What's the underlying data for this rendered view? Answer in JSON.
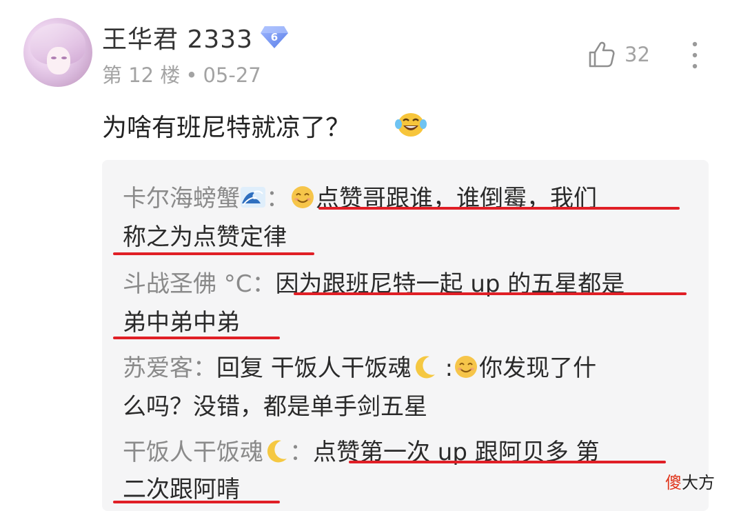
{
  "user": {
    "name": "王华君 2333",
    "level": "6",
    "floor": "第 12 楼",
    "separator": "•",
    "date": "05-27"
  },
  "actions": {
    "like_count": "32"
  },
  "comment": {
    "text": "为啥有班尼特就凉了？",
    "emoji": "laughing-tears-emoji"
  },
  "replies": [
    {
      "author": "卡尔海螃蟹",
      "author_emoji": "wave-emoji",
      "colon": "：",
      "text_emoji": "smile-emoji",
      "text_line1": "点赞哥跟谁，谁倒霉，我们",
      "text_line2": "称之为点赞定律"
    },
    {
      "author": "斗战圣佛 °C",
      "colon": "：",
      "text_line1": "因为跟班尼特一起 up 的五星都是",
      "text_line2": "弟中弟中弟"
    },
    {
      "author": "苏爱客",
      "colon": "：",
      "reply_prefix": "回复 ",
      "reply_target": "干饭人干饭魂",
      "reply_target_emoji": "moon-emoji",
      "reply_colon": " :",
      "text_emoji": "smile-emoji",
      "text_line1": "你发现了什",
      "text_line2": "么吗？没错，都是单手剑五星"
    },
    {
      "author": "干饭人干饭魂",
      "author_emoji": "moon-emoji",
      "colon": "：",
      "text_line1": "点赞第一次 up 跟阿贝多 第",
      "text_line2": "二次跟阿晴"
    }
  ],
  "watermark": {
    "first": "傻",
    "rest": "大方"
  },
  "colors": {
    "underline": "#e01f26",
    "badge": "#6d8ff0",
    "reply_bg": "#f5f5f6"
  }
}
